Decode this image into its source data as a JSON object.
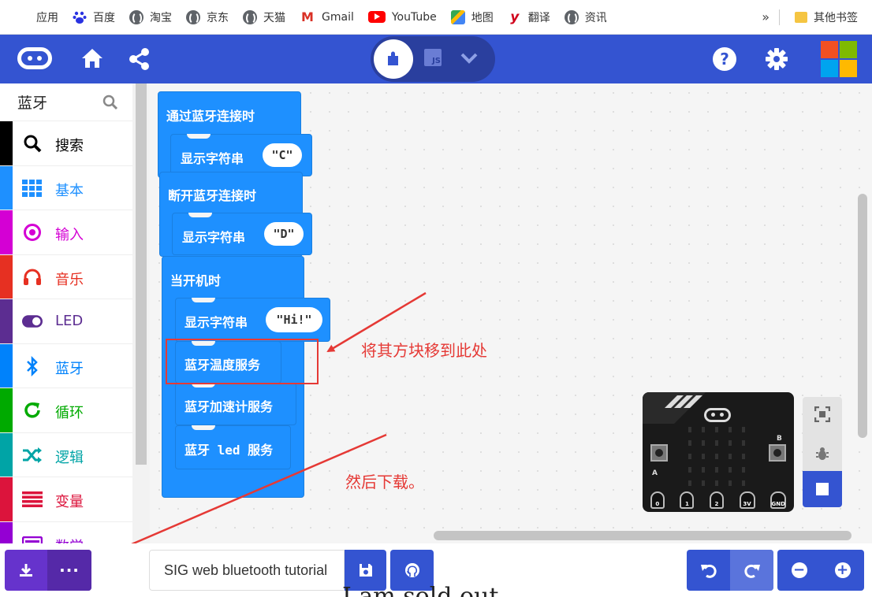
{
  "bookmarks": {
    "items": [
      {
        "label": "应用",
        "icon": "apps-icon"
      },
      {
        "label": "百度",
        "icon": "baidu-icon"
      },
      {
        "label": "淘宝",
        "icon": "globe-icon"
      },
      {
        "label": "京东",
        "icon": "globe-icon"
      },
      {
        "label": "天猫",
        "icon": "globe-icon"
      },
      {
        "label": "Gmail",
        "icon": "gmail-icon"
      },
      {
        "label": "YouTube",
        "icon": "youtube-icon"
      },
      {
        "label": "地图",
        "icon": "maps-icon"
      },
      {
        "label": "翻译",
        "icon": "youdao-icon"
      },
      {
        "label": "资讯",
        "icon": "globe-icon"
      }
    ],
    "more": "»",
    "other_bookmarks": "其他书签"
  },
  "header": {
    "js_label": "JS",
    "help_label": "?",
    "accent_color": "#3454d1"
  },
  "toolbox": {
    "title": "蓝牙",
    "categories": [
      {
        "label": "搜索",
        "color": "#000000",
        "icon": "search-icon"
      },
      {
        "label": "基本",
        "color": "#1e90ff",
        "icon": "grid-icon"
      },
      {
        "label": "输入",
        "color": "#d400d4",
        "icon": "target-icon"
      },
      {
        "label": "音乐",
        "color": "#e63022",
        "icon": "headphones-icon"
      },
      {
        "label": "LED",
        "color": "#5c2d91",
        "icon": "toggle-icon"
      },
      {
        "label": "蓝牙",
        "color": "#0082fb",
        "icon": "bluetooth-icon"
      },
      {
        "label": "循环",
        "color": "#00aa00",
        "icon": "refresh-icon"
      },
      {
        "label": "逻辑",
        "color": "#00a4a6",
        "icon": "shuffle-icon"
      },
      {
        "label": "变量",
        "color": "#dc143c",
        "icon": "lines-icon"
      },
      {
        "label": "数学",
        "color": "#9400d3",
        "icon": "calculator-icon"
      }
    ]
  },
  "workspace": {
    "blocks": {
      "on_connected": "通过蓝牙连接时",
      "show_string_1": "显示字符串",
      "value_1": "\"C\"",
      "on_disconnected": "断开蓝牙连接时",
      "show_string_2": "显示字符串",
      "value_2": "\"D\"",
      "on_start": "当开机时",
      "show_string_3": "显示字符串",
      "value_3": "\"Hi!\"",
      "temp_service": "蓝牙温度服务",
      "accel_service": "蓝牙加速计服务",
      "led_service": "蓝牙 led 服务"
    },
    "annotations": {
      "move_here": "将其方块移到此处",
      "then_download": "然后下载。"
    }
  },
  "simulator": {
    "pins": [
      "0",
      "1",
      "2",
      "3V",
      "GND"
    ],
    "button_a": "A",
    "button_b": "B"
  },
  "bottom": {
    "project_name": "SIG web bluetooth tutorial"
  },
  "overlay_text": "I am sold out"
}
